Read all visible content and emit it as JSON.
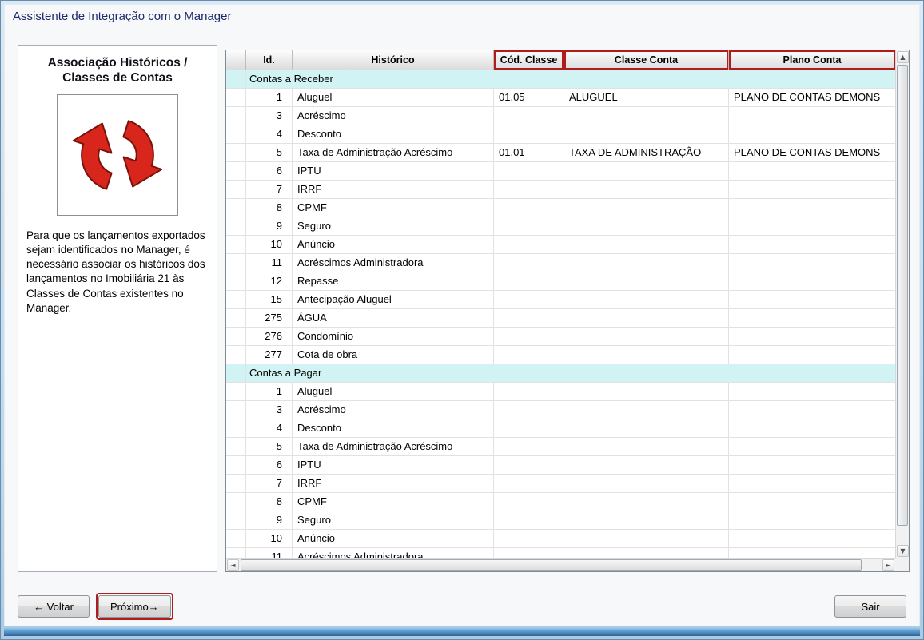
{
  "window": {
    "title": "Assistente de Integração com o Manager"
  },
  "sidebar": {
    "heading": "Associação Históricos / Classes de Contas",
    "icon": "sync-arrows-icon",
    "description": "Para que os lançamentos exportados sejam identificados no Manager, é necessário associar os históricos dos lançamentos no Imobiliária 21 às Classes de Contas existentes no Manager."
  },
  "grid": {
    "columns": [
      {
        "key": "id",
        "label": "Id.",
        "highlighted": false
      },
      {
        "key": "historico",
        "label": "Histórico",
        "highlighted": false
      },
      {
        "key": "cod_classe",
        "label": "Cód. Classe",
        "highlighted": true
      },
      {
        "key": "classe_conta",
        "label": "Classe Conta",
        "highlighted": true
      },
      {
        "key": "plano_conta",
        "label": "Plano Conta",
        "highlighted": true
      }
    ],
    "sections": [
      {
        "label": "Contas a Receber",
        "rows": [
          {
            "id": "1",
            "historico": "Aluguel",
            "cod_classe": "01.05",
            "classe_conta": "ALUGUEL",
            "plano_conta": "PLANO DE CONTAS DEMONS"
          },
          {
            "id": "3",
            "historico": "Acréscimo"
          },
          {
            "id": "4",
            "historico": "Desconto"
          },
          {
            "id": "5",
            "historico": "Taxa de Administração Acréscimo",
            "cod_classe": "01.01",
            "classe_conta": "TAXA DE ADMINISTRAÇÃO",
            "plano_conta": "PLANO DE CONTAS DEMONS"
          },
          {
            "id": "6",
            "historico": "IPTU"
          },
          {
            "id": "7",
            "historico": "IRRF"
          },
          {
            "id": "8",
            "historico": "CPMF"
          },
          {
            "id": "9",
            "historico": "Seguro"
          },
          {
            "id": "10",
            "historico": "Anúncio"
          },
          {
            "id": "11",
            "historico": "Acréscimos Administradora"
          },
          {
            "id": "12",
            "historico": "Repasse"
          },
          {
            "id": "15",
            "historico": "Antecipação Aluguel"
          },
          {
            "id": "275",
            "historico": "ÁGUA"
          },
          {
            "id": "276",
            "historico": "Condomínio"
          },
          {
            "id": "277",
            "historico": "Cota de obra"
          }
        ]
      },
      {
        "label": "Contas a Pagar",
        "rows": [
          {
            "id": "1",
            "historico": "Aluguel"
          },
          {
            "id": "3",
            "historico": "Acréscimo"
          },
          {
            "id": "4",
            "historico": "Desconto"
          },
          {
            "id": "5",
            "historico": "Taxa de Administração Acréscimo"
          },
          {
            "id": "6",
            "historico": "IPTU"
          },
          {
            "id": "7",
            "historico": "IRRF"
          },
          {
            "id": "8",
            "historico": "CPMF"
          },
          {
            "id": "9",
            "historico": "Seguro"
          },
          {
            "id": "10",
            "historico": "Anúncio"
          },
          {
            "id": "11",
            "historico": "Acréscimos Administradora"
          }
        ]
      }
    ]
  },
  "scrollbar": {
    "up": "▲",
    "down": "▼",
    "left": "◄",
    "right": "►"
  },
  "footer": {
    "back_label": "← Voltar",
    "next_label": "Próximo→",
    "exit_label": "Sair"
  },
  "colors": {
    "highlight_red": "#b01b1b",
    "section_row_bg": "#d2f3f3",
    "frame_blue": "#bdd9ee",
    "title_text": "#1c2a6a"
  }
}
